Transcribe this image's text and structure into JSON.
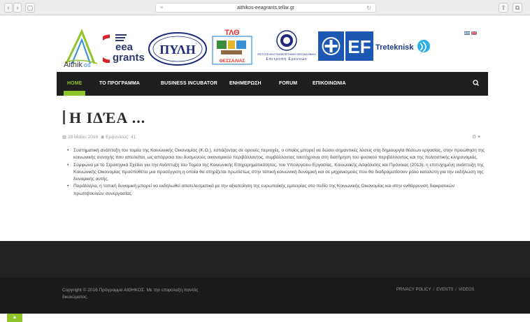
{
  "browser": {
    "url": "aithikos-eeagrants.tellar.gr",
    "reader_icon": "reader-icon",
    "reload_icon": "reload-icon",
    "share_icon": "share-icon",
    "tabs_icon": "tabs-icon"
  },
  "logos": {
    "aithikos": "Aithikos",
    "eea": "eea",
    "grants": "grants",
    "pyli": "ΠΥΛΗ",
    "thessalia": "ΘΕΣΣΑΛΙΑΣ",
    "university": "Επιτροπή Ερευνών",
    "treteknisk": "Treteknisk"
  },
  "nav": {
    "items": [
      "HOME",
      "ΤΟ ΠΡΟΓΡΑΜΜΑ",
      "BUSINESS INCUBATOR",
      "ΕΝΗΜΕΡΩΣΗ",
      "FORUM",
      "ΕΠΙΚΟΙΝΩΝΙΑ"
    ],
    "search_icon": "search-icon"
  },
  "article": {
    "title": "Η ΙΔΈΑ ...",
    "date": "28 Μαΐου 2016",
    "views": "Εμφανίσεις: 41",
    "bullets": [
      "Συστηματική ανάπτυξη του τομέα της Κοινωνικής Οικονομίας (Κ.Ο.), εστιάζοντας σε ορεινές περιοχές, ο οποίος μπορεί να δώσει σημαντικές λύσεις στη δημιουργία θέσεων εργασίας, στην προώθηση της κοινωνικής συνοχής που απειλείται, ως απόρροια του δυσμενούς οικονομικού περιβάλλοντος, συμβάλλοντας ταυτόχρονα στη διατήρηση του φυσικού περιβάλλοντος και της πολιτιστικής κληρονομιάς.",
      "Σύμφωνα με το Στρατηγικό Σχέδιο για την Ανάπτυξη του Τομέα της Κοινωνικής Επιχειρηματικότητας, του Υπουργείου Εργασίας, Κοινωνικής Ασφάλισης και Πρόνοιας (2013), η επιτυχημένη ανάπτυξη της Κοινωνικής Οικονομίας προϋποθέτει μια προσέγγιση η οποία θα στηρίζεται πρωτίστως στην τοπική κοινωνική δυναμική και σε μηχανισμούς που θα διαδραματίσουν ρόλο καταλύτη για την εκδήλωση της δυναμικής αυτής.",
      "Παράλληλα, η τοπική δυναμική μπορεί να εκδηλωθεί αποτελεσματικά με την αξιοποίηση της ευρωπαϊκής εμπειρίας στο πεδίο της Κοινωνικής Οικονομίας και στην ενθάρρυνση διακρατικών πρωτοβουλιών συνεργασίας."
    ]
  },
  "footer": {
    "copyright": "Copyright © 2016 Πρόγραμμα ΑΙΘΗΚΟΣ. Με την επιφύλαξη παντός δικαιώματος.",
    "links": [
      "PRIVACY POLICY",
      "EVENTS",
      "VIDEOS"
    ]
  },
  "colors": {
    "accent": "#8fc32a",
    "nav_bg": "#1e1e1e",
    "footer_bg": "#222222"
  }
}
